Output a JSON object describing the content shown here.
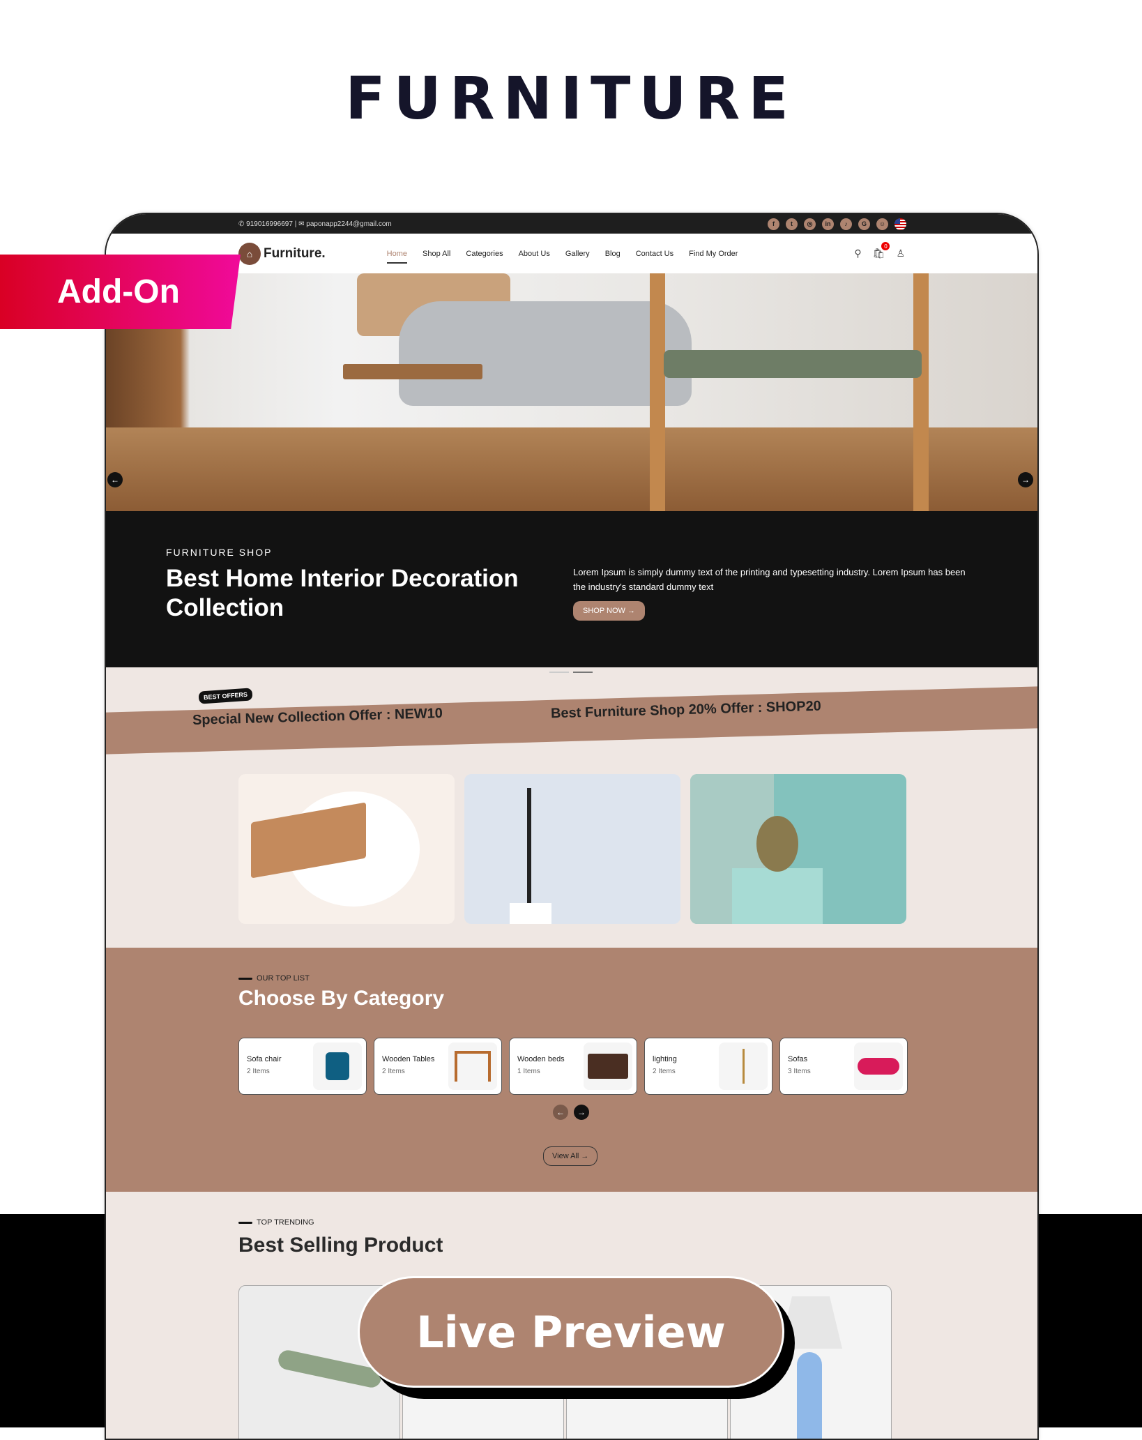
{
  "title": "FURNITURE",
  "addon_label": "Add-On",
  "live_preview_label": "Live Preview",
  "topbar": {
    "phone": "919016996697",
    "email": "paponapp2244@gmail.com",
    "socials": [
      "facebook",
      "twitter",
      "instagram",
      "linkedin",
      "tiktok",
      "google",
      "snapchat"
    ],
    "language": "us-flag"
  },
  "nav": {
    "brand": "Furniture.",
    "items": [
      "Home",
      "Shop All",
      "Categories",
      "About Us",
      "Gallery",
      "Blog",
      "Contact Us",
      "Find My Order"
    ],
    "active": "Home",
    "cart_count": "0"
  },
  "hero": {
    "kicker": "FURNITURE SHOP",
    "headline": "Best Home Interior Decoration Collection",
    "description": "Lorem Ipsum is simply dummy text of the printing and typesetting industry. Lorem Ipsum has been the industry's standard dummy text",
    "button": "SHOP NOW"
  },
  "offers": {
    "badge": "BEST OFFERS",
    "items": [
      "Special New Collection Offer : NEW10",
      "Best Furniture Shop 20% Offer : SHOP20"
    ]
  },
  "categories": {
    "kicker": "OUR TOP LIST",
    "title": "Choose By Category",
    "items": [
      {
        "name": "Sofa chair",
        "count": "2 Items"
      },
      {
        "name": "Wooden Tables",
        "count": "2 Items"
      },
      {
        "name": "Wooden beds",
        "count": "1 Items"
      },
      {
        "name": "lighting",
        "count": "2 Items"
      },
      {
        "name": "Sofas",
        "count": "3 Items"
      }
    ],
    "view_all": "View All"
  },
  "best_selling": {
    "kicker": "TOP TRENDING",
    "title": "Best Selling Product"
  },
  "colors": {
    "accent": "#ae8470",
    "dark": "#121212",
    "light_bg": "#efe7e3",
    "addon_start": "#d90024",
    "addon_end": "#f00a9a"
  }
}
